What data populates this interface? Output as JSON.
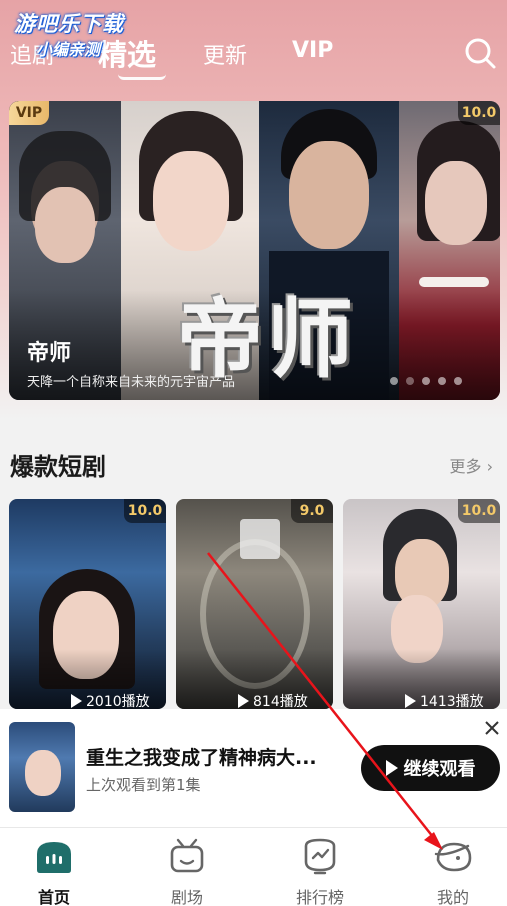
{
  "watermark": {
    "line1": "游吧乐下载",
    "line2": "小编亲测"
  },
  "top_nav": {
    "tabs": [
      {
        "label": "追剧"
      },
      {
        "label": "精选",
        "active": true
      },
      {
        "label": "更新"
      },
      {
        "label": "VIP"
      }
    ],
    "search_icon": "search-icon"
  },
  "banner": {
    "vip_badge": "VIP",
    "score": "10.0",
    "big_title": "帝师",
    "title": "帝师",
    "subtitle": "天降一个自称来自未来的元宇宙产品",
    "dot_count": 5
  },
  "section": {
    "title": "爆款短剧",
    "more": "更多",
    "more_icon": "chevron-right-icon",
    "cards": [
      {
        "score": "10.0",
        "plays": "2010播放"
      },
      {
        "score": "9.0",
        "plays": "814播放"
      },
      {
        "score": "10.0",
        "plays": "1413播放"
      }
    ]
  },
  "continue_watching": {
    "title": "重生之我变成了精神病大...",
    "subtitle": "上次观看到第1集",
    "button_label": "继续观看",
    "close_icon": "close-icon"
  },
  "bottom_nav": {
    "items": [
      {
        "label": "首页",
        "icon": "home-icon",
        "active": true
      },
      {
        "label": "剧场",
        "icon": "tv-icon"
      },
      {
        "label": "排行榜",
        "icon": "ranking-icon"
      },
      {
        "label": "我的",
        "icon": "profile-icon"
      }
    ]
  },
  "colors": {
    "accent_green": "#1f6e6a",
    "score_gold": "#f3c969",
    "annotation_red": "#e8141b"
  }
}
